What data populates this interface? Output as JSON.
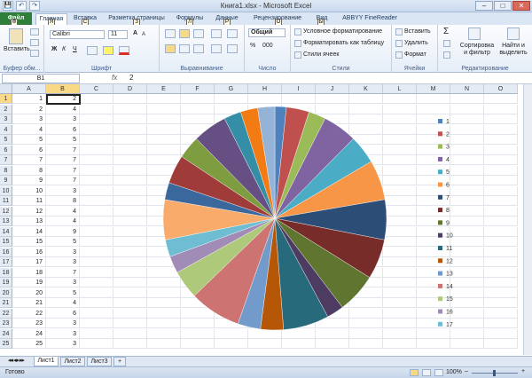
{
  "window": {
    "title": "Книга1.xlsx - Microsoft Excel",
    "minimize": "–",
    "maximize": "□",
    "close": "✕"
  },
  "qat": [
    "💾",
    "↶",
    "↷"
  ],
  "tabs": {
    "file": "Файл",
    "items": [
      "Главная",
      "Вставка",
      "Разметка страницы",
      "Формулы",
      "Данные",
      "Рецензирование",
      "Вид",
      "ABBYY FineReader 11"
    ],
    "keytips": [
      "Ф",
      "Я",
      "С",
      "З",
      "Л",
      "Р",
      "О",
      "Ы"
    ]
  },
  "ribbon": {
    "clipboard": {
      "label": "Буфер обм...",
      "paste": "Вставить"
    },
    "font": {
      "label": "Шрифт",
      "font_name": "Calibri",
      "font_size": "11",
      "bold": "Ж",
      "italic": "К",
      "underline": "Ч",
      "grow": "A",
      "shrink": "A"
    },
    "alignment": {
      "label": "Выравнивание"
    },
    "number": {
      "label": "Число",
      "format": "Общий",
      "currency": "%",
      "percent": "000"
    },
    "styles": {
      "label": "Стили",
      "conditional": "Условное форматирование",
      "as_table": "Форматировать как таблицу",
      "cell_styles": "Стили ячеек"
    },
    "cells": {
      "label": "Ячейки",
      "insert": "Вставить",
      "delete": "Удалить",
      "format": "Формат"
    },
    "editing": {
      "label": "Редактирование",
      "sum": "Σ",
      "sort": "Сортировка и фильтр",
      "find": "Найти и выделить"
    }
  },
  "formula_bar": {
    "name_box": "B1",
    "fx": "fx",
    "value": "2"
  },
  "grid": {
    "columns": [
      "A",
      "B",
      "C",
      "D",
      "E",
      "F",
      "G",
      "H",
      "I",
      "J",
      "K",
      "L",
      "M",
      "N",
      "O"
    ],
    "selected_col": "B",
    "selected_row": 1,
    "rows": [
      [
        "1",
        "2"
      ],
      [
        "2",
        "4"
      ],
      [
        "3",
        "3"
      ],
      [
        "4",
        "6"
      ],
      [
        "5",
        "5"
      ],
      [
        "6",
        "7"
      ],
      [
        "7",
        "7"
      ],
      [
        "8",
        "7"
      ],
      [
        "9",
        "7"
      ],
      [
        "10",
        "3"
      ],
      [
        "11",
        "8"
      ],
      [
        "12",
        "4"
      ],
      [
        "13",
        "4"
      ],
      [
        "14",
        "9"
      ],
      [
        "15",
        "5"
      ],
      [
        "16",
        "3"
      ],
      [
        "17",
        "3"
      ],
      [
        "18",
        "7"
      ],
      [
        "19",
        "3"
      ],
      [
        "20",
        "5"
      ],
      [
        "21",
        "4"
      ],
      [
        "22",
        "6"
      ],
      [
        "23",
        "3"
      ],
      [
        "24",
        "3"
      ],
      [
        "25",
        "3"
      ]
    ]
  },
  "chart_data": {
    "type": "pie",
    "categories": [
      "1",
      "2",
      "3",
      "4",
      "5",
      "6",
      "7",
      "8",
      "9",
      "10",
      "11",
      "12",
      "13",
      "14",
      "15",
      "16",
      "17",
      "18",
      "19",
      "20",
      "21",
      "22",
      "23",
      "24",
      "25"
    ],
    "values": [
      2,
      4,
      3,
      6,
      5,
      7,
      7,
      7,
      7,
      3,
      8,
      4,
      4,
      9,
      5,
      3,
      3,
      7,
      3,
      5,
      4,
      6,
      3,
      3,
      3
    ],
    "legend_entries": [
      "1",
      "2",
      "3",
      "4",
      "5",
      "6",
      "7",
      "8",
      "9",
      "10",
      "11",
      "12",
      "13",
      "14",
      "15",
      "16",
      "17"
    ],
    "legend_position": "right",
    "colors": [
      "#4f81bd",
      "#c0504d",
      "#9bbb59",
      "#8064a2",
      "#4bacc6",
      "#f79646",
      "#2c4d75",
      "#772c2a",
      "#5f7530",
      "#4d3b62",
      "#276a7c",
      "#b65708",
      "#729aca",
      "#cd7371",
      "#afc97a",
      "#a08cb6",
      "#6fbdd2",
      "#f9ab6b",
      "#3a679c",
      "#9f3b38",
      "#7e9c40",
      "#664f83",
      "#348ea5",
      "#f37b13",
      "#95b3d7"
    ]
  },
  "sheets": [
    "Лист1",
    "Лист2",
    "Лист3"
  ],
  "status": {
    "ready": "Готово",
    "zoom": "100%",
    "minus": "–",
    "plus": "+"
  }
}
